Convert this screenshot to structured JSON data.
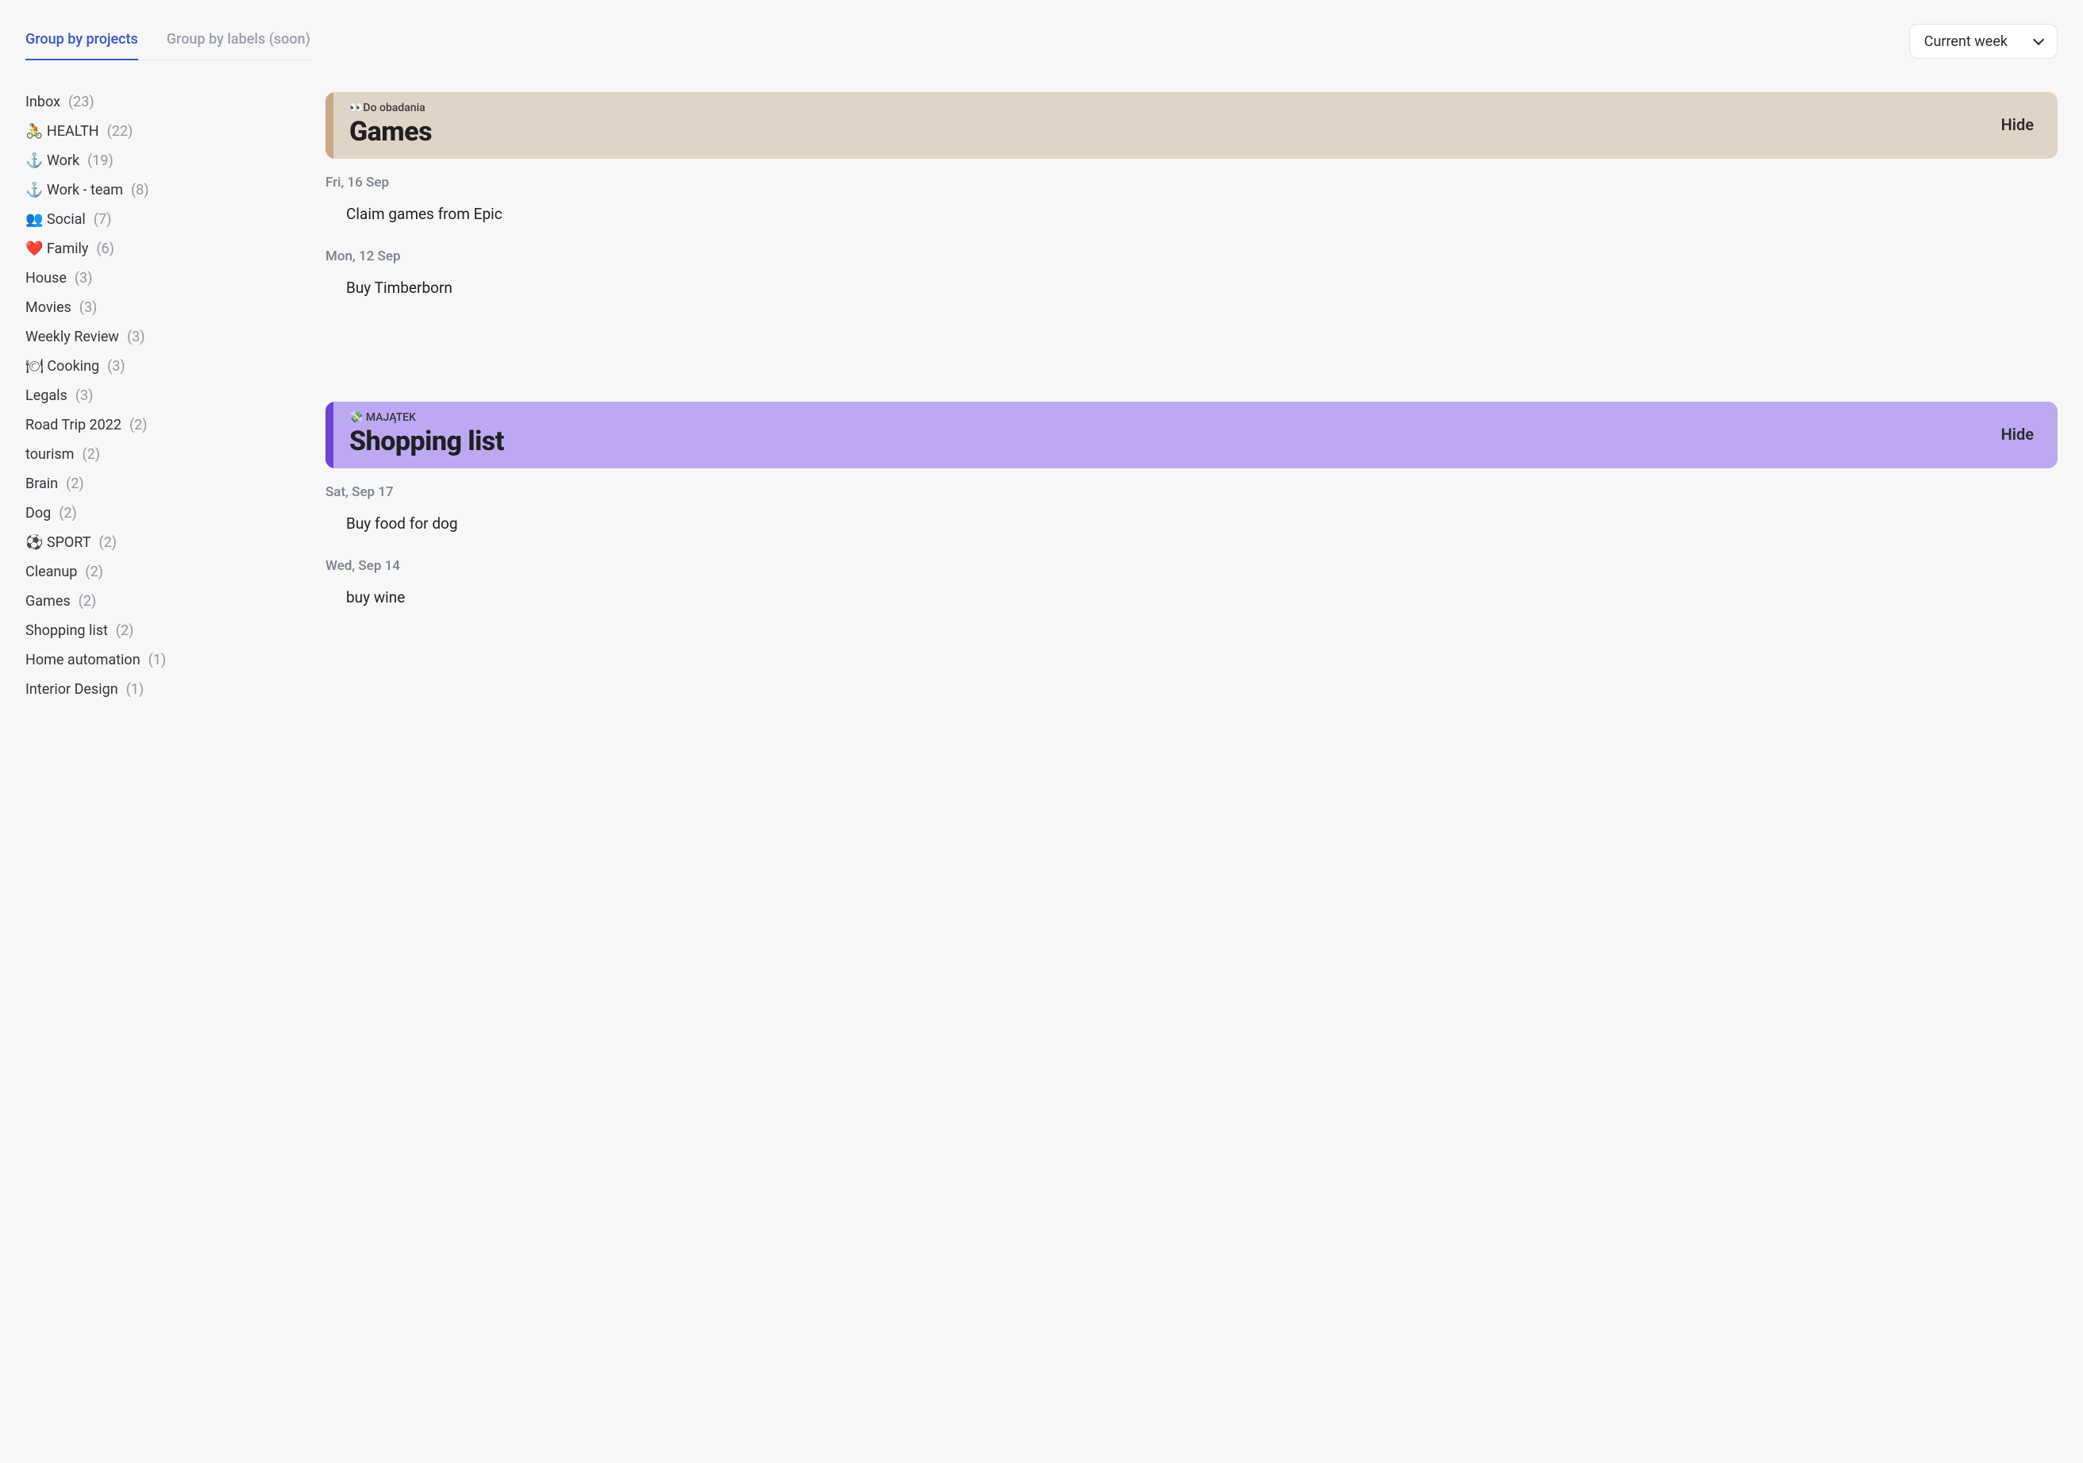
{
  "tabs": [
    {
      "label": "Group by projects",
      "active": true
    },
    {
      "label": "Group by labels (soon)",
      "active": false
    }
  ],
  "period": {
    "selected": "Current week"
  },
  "hide_label": "Hide",
  "sidebar": {
    "items": [
      {
        "name": "Inbox",
        "count": 23
      },
      {
        "name": "🚴 HEALTH",
        "count": 22
      },
      {
        "name": "⚓ Work",
        "count": 19
      },
      {
        "name": "⚓ Work - team",
        "count": 8
      },
      {
        "name": "👥 Social",
        "count": 7
      },
      {
        "name": "❤️ Family",
        "count": 6
      },
      {
        "name": "House",
        "count": 3
      },
      {
        "name": "Movies",
        "count": 3
      },
      {
        "name": "Weekly Review",
        "count": 3
      },
      {
        "name": "🍽 Cooking",
        "count": 3
      },
      {
        "name": "Legals",
        "count": 3
      },
      {
        "name": "Road Trip 2022",
        "count": 2
      },
      {
        "name": "tourism",
        "count": 2
      },
      {
        "name": "Brain",
        "count": 2
      },
      {
        "name": "Dog",
        "count": 2
      },
      {
        "name": "⚽ SPORT",
        "count": 2
      },
      {
        "name": "Cleanup",
        "count": 2
      },
      {
        "name": "Games",
        "count": 2
      },
      {
        "name": "Shopping list",
        "count": 2
      },
      {
        "name": "Home automation",
        "count": 1
      },
      {
        "name": "Interior Design",
        "count": 1
      }
    ]
  },
  "groups": [
    {
      "color": "beige",
      "parent": "👀Do obadania",
      "title": "Games",
      "days": [
        {
          "label": "Fri, 16 Sep",
          "tasks": [
            "Claim games from Epic"
          ]
        },
        {
          "label": "Mon, 12 Sep",
          "tasks": [
            "Buy Timberborn"
          ]
        }
      ]
    },
    {
      "color": "purple",
      "parent": "💸 MAJĄTEK",
      "title": "Shopping list",
      "days": [
        {
          "label": "Sat, Sep 17",
          "tasks": [
            "Buy food for dog"
          ]
        },
        {
          "label": "Wed, Sep 14",
          "tasks": [
            "buy wine"
          ]
        }
      ]
    }
  ]
}
